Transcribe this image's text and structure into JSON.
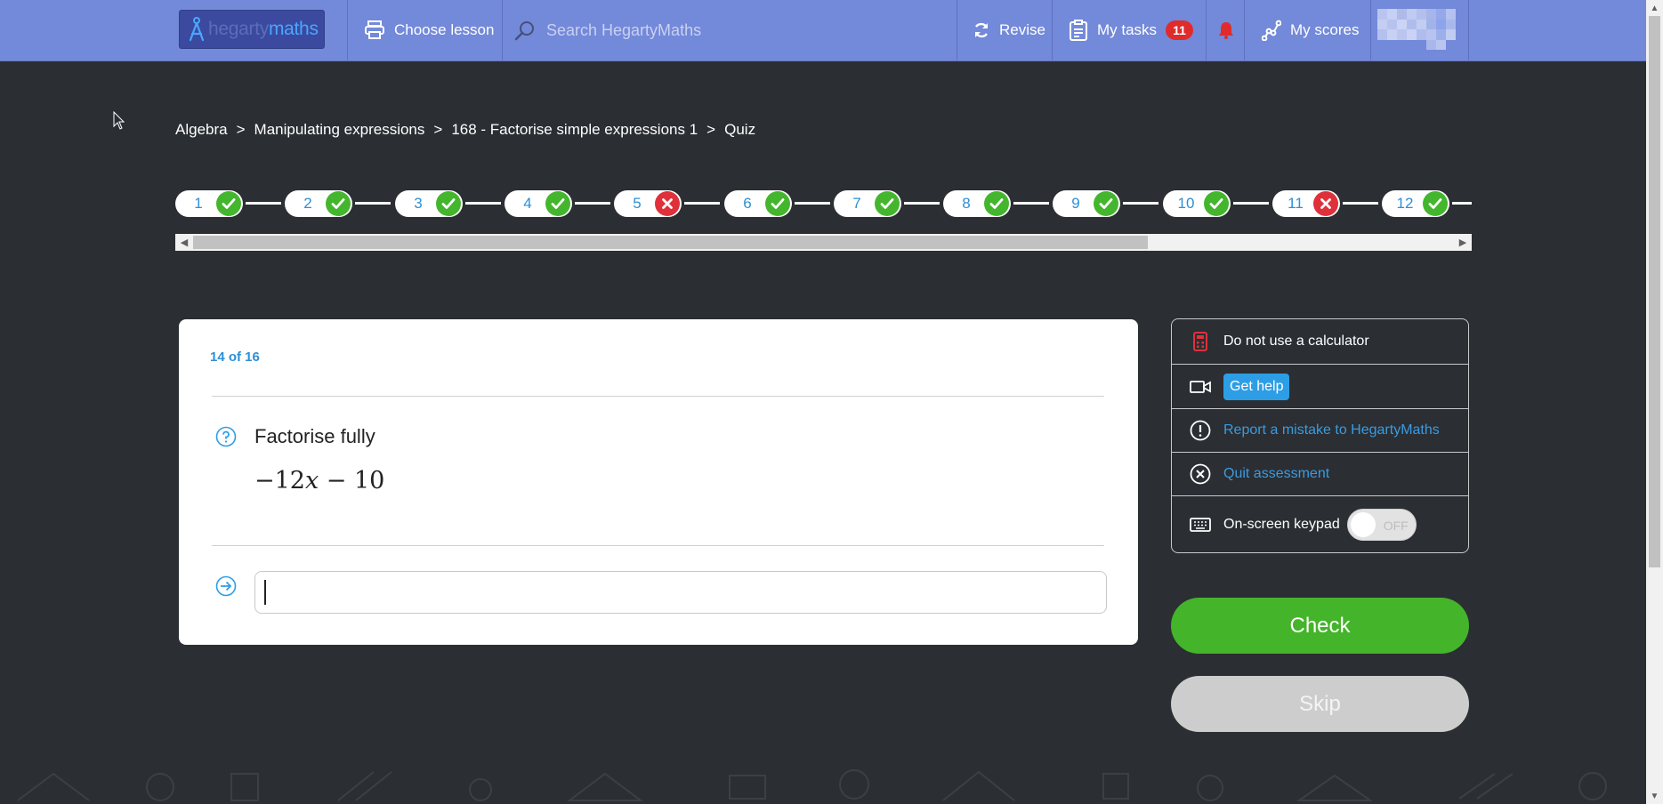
{
  "header": {
    "logo_text_a": "hegarty",
    "logo_text_b": "maths",
    "choose_lesson": "Choose lesson",
    "search_placeholder": "Search HegartyMaths",
    "revise": "Revise",
    "my_tasks": "My tasks",
    "tasks_count": "11",
    "my_scores": "My scores"
  },
  "breadcrumb": [
    "Algebra",
    "Manipulating expressions",
    "168 - Factorise simple expressions 1",
    "Quiz"
  ],
  "breadcrumb_sep": ">",
  "steps": [
    {
      "n": "1",
      "status": "correct"
    },
    {
      "n": "2",
      "status": "correct"
    },
    {
      "n": "3",
      "status": "correct"
    },
    {
      "n": "4",
      "status": "correct"
    },
    {
      "n": "5",
      "status": "incorrect"
    },
    {
      "n": "6",
      "status": "correct"
    },
    {
      "n": "7",
      "status": "correct"
    },
    {
      "n": "8",
      "status": "correct"
    },
    {
      "n": "9",
      "status": "correct"
    },
    {
      "n": "10",
      "status": "correct"
    },
    {
      "n": "11",
      "status": "incorrect"
    },
    {
      "n": "12",
      "status": "correct"
    }
  ],
  "question": {
    "counter": "14 of 16",
    "prompt": "Factorise fully",
    "expr_coef": "−12",
    "expr_var": "x",
    "expr_rest": " − 10",
    "answer_value": ""
  },
  "side": {
    "calculator": "Do not use a calculator",
    "get_help": "Get help",
    "report": "Report a mistake to HegartyMaths",
    "quit": "Quit assessment",
    "keypad": "On-screen keypad",
    "keypad_state": "OFF"
  },
  "buttons": {
    "check": "Check",
    "skip": "Skip"
  },
  "colors": {
    "nav": "#7389d9",
    "page": "#2b2e33",
    "correct": "#44b62e",
    "incorrect": "#e0303a",
    "accent": "#2d8fd6",
    "check": "#44b42a"
  }
}
